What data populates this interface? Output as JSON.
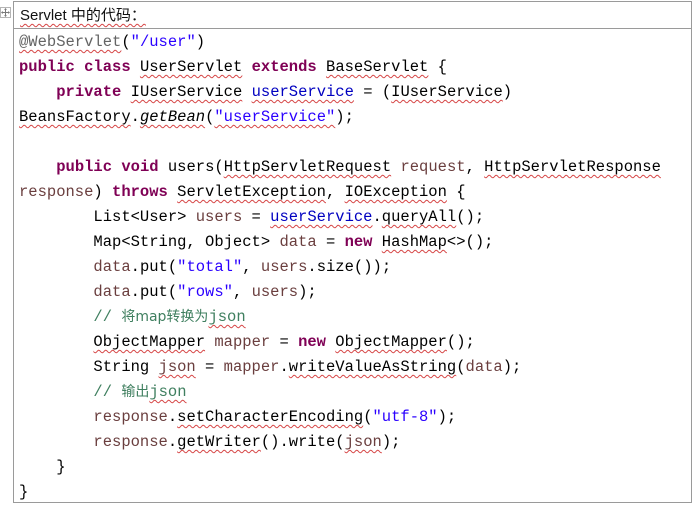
{
  "header": {
    "text": "Servlet 中的代码："
  },
  "code": {
    "lines": [
      [
        {
          "t": "@WebServlet",
          "c": "ann",
          "w": 1
        },
        {
          "t": "(",
          "c": ""
        },
        {
          "t": "\"/user\"",
          "c": "str"
        },
        {
          "t": ")",
          "c": ""
        }
      ],
      [
        {
          "t": "public",
          "c": "kw"
        },
        {
          "t": " ",
          "c": ""
        },
        {
          "t": "class",
          "c": "kw"
        },
        {
          "t": " ",
          "c": ""
        },
        {
          "t": "UserServlet",
          "c": "",
          "w": 1
        },
        {
          "t": " ",
          "c": ""
        },
        {
          "t": "extends",
          "c": "kw"
        },
        {
          "t": " ",
          "c": ""
        },
        {
          "t": "BaseServlet",
          "c": "",
          "w": 1
        },
        {
          "t": " {",
          "c": ""
        }
      ],
      [
        {
          "t": "    ",
          "c": ""
        },
        {
          "t": "private",
          "c": "kw"
        },
        {
          "t": " ",
          "c": ""
        },
        {
          "t": "IUserService",
          "c": "",
          "w": 1
        },
        {
          "t": " ",
          "c": ""
        },
        {
          "t": "userService",
          "c": "fld",
          "w": 1
        },
        {
          "t": " = (",
          "c": ""
        },
        {
          "t": "IUserService",
          "c": "",
          "w": 1
        },
        {
          "t": ")",
          "c": ""
        }
      ],
      [
        {
          "t": "BeansFactory",
          "c": "",
          "w": 1
        },
        {
          "t": ".",
          "c": ""
        },
        {
          "t": "getBean",
          "c": "mi",
          "w": 1
        },
        {
          "t": "(",
          "c": ""
        },
        {
          "t": "\"userService\"",
          "c": "str",
          "w": 1
        },
        {
          "t": ");",
          "c": ""
        }
      ],
      [],
      [
        {
          "t": "    ",
          "c": ""
        },
        {
          "t": "public",
          "c": "kw"
        },
        {
          "t": " ",
          "c": ""
        },
        {
          "t": "void",
          "c": "kw"
        },
        {
          "t": " users(",
          "c": ""
        },
        {
          "t": "HttpServletRequest",
          "c": "",
          "w": 1
        },
        {
          "t": " ",
          "c": ""
        },
        {
          "t": "request",
          "c": "var"
        },
        {
          "t": ", ",
          "c": ""
        },
        {
          "t": "HttpServletResponse",
          "c": "",
          "w": 1
        }
      ],
      [
        {
          "t": "response",
          "c": "var"
        },
        {
          "t": ") ",
          "c": ""
        },
        {
          "t": "throws",
          "c": "kw"
        },
        {
          "t": " ",
          "c": ""
        },
        {
          "t": "ServletException",
          "c": "",
          "w": 1
        },
        {
          "t": ", ",
          "c": ""
        },
        {
          "t": "IOException",
          "c": "",
          "w": 1
        },
        {
          "t": " {",
          "c": ""
        }
      ],
      [
        {
          "t": "        List<User> ",
          "c": ""
        },
        {
          "t": "users",
          "c": "var"
        },
        {
          "t": " = ",
          "c": ""
        },
        {
          "t": "userService",
          "c": "fld",
          "w": 1
        },
        {
          "t": ".",
          "c": ""
        },
        {
          "t": "queryAll",
          "c": "",
          "w": 1
        },
        {
          "t": "();",
          "c": ""
        }
      ],
      [
        {
          "t": "        Map<String, Object> ",
          "c": ""
        },
        {
          "t": "data",
          "c": "var"
        },
        {
          "t": " = ",
          "c": ""
        },
        {
          "t": "new",
          "c": "kw"
        },
        {
          "t": " ",
          "c": ""
        },
        {
          "t": "HashMap",
          "c": "",
          "w": 1
        },
        {
          "t": "<>();",
          "c": ""
        }
      ],
      [
        {
          "t": "        ",
          "c": ""
        },
        {
          "t": "data",
          "c": "var"
        },
        {
          "t": ".put(",
          "c": ""
        },
        {
          "t": "\"total\"",
          "c": "str"
        },
        {
          "t": ", ",
          "c": ""
        },
        {
          "t": "users",
          "c": "var"
        },
        {
          "t": ".size());",
          "c": ""
        }
      ],
      [
        {
          "t": "        ",
          "c": ""
        },
        {
          "t": "data",
          "c": "var"
        },
        {
          "t": ".put(",
          "c": ""
        },
        {
          "t": "\"rows\"",
          "c": "str"
        },
        {
          "t": ", ",
          "c": ""
        },
        {
          "t": "users",
          "c": "var"
        },
        {
          "t": ");",
          "c": ""
        }
      ],
      [
        {
          "t": "        // ",
          "c": "cmt"
        },
        {
          "t": "将map转换为",
          "c": "cmt cn"
        },
        {
          "t": "json",
          "c": "cmt",
          "w": 1
        }
      ],
      [
        {
          "t": "        ",
          "c": ""
        },
        {
          "t": "ObjectMapper",
          "c": "",
          "w": 1
        },
        {
          "t": " ",
          "c": ""
        },
        {
          "t": "mapper",
          "c": "var"
        },
        {
          "t": " = ",
          "c": ""
        },
        {
          "t": "new",
          "c": "kw"
        },
        {
          "t": " ",
          "c": ""
        },
        {
          "t": "ObjectMapper",
          "c": "",
          "w": 1
        },
        {
          "t": "();",
          "c": ""
        }
      ],
      [
        {
          "t": "        String ",
          "c": ""
        },
        {
          "t": "json",
          "c": "var",
          "w": 1
        },
        {
          "t": " = ",
          "c": ""
        },
        {
          "t": "mapper",
          "c": "var"
        },
        {
          "t": ".",
          "c": ""
        },
        {
          "t": "writeValueAsString",
          "c": "",
          "w": 1
        },
        {
          "t": "(",
          "c": ""
        },
        {
          "t": "data",
          "c": "var"
        },
        {
          "t": ");",
          "c": ""
        }
      ],
      [
        {
          "t": "        // ",
          "c": "cmt"
        },
        {
          "t": "输出",
          "c": "cmt cn"
        },
        {
          "t": "json",
          "c": "cmt",
          "w": 1
        }
      ],
      [
        {
          "t": "        ",
          "c": ""
        },
        {
          "t": "response",
          "c": "var"
        },
        {
          "t": ".",
          "c": ""
        },
        {
          "t": "setCharacterEncoding",
          "c": "",
          "w": 1
        },
        {
          "t": "(",
          "c": ""
        },
        {
          "t": "\"utf-8\"",
          "c": "str"
        },
        {
          "t": ");",
          "c": ""
        }
      ],
      [
        {
          "t": "        ",
          "c": ""
        },
        {
          "t": "response",
          "c": "var"
        },
        {
          "t": ".",
          "c": ""
        },
        {
          "t": "getWriter",
          "c": "",
          "w": 1
        },
        {
          "t": "().write(",
          "c": ""
        },
        {
          "t": "json",
          "c": "var",
          "w": 1
        },
        {
          "t": ");",
          "c": ""
        }
      ],
      [
        {
          "t": "    }",
          "c": ""
        }
      ],
      [
        {
          "t": "}",
          "c": ""
        }
      ]
    ]
  }
}
